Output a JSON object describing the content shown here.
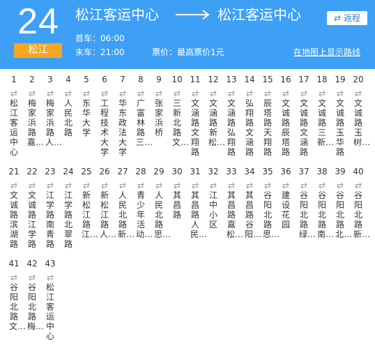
{
  "header": {
    "route_number": "24",
    "district": "松江",
    "from": "松江客运中心",
    "to": "松江客运中心",
    "first_bus": "首车：06:00",
    "last_bus": "末车：21:00",
    "price": "票价：最高票价1元",
    "return_label": "⇄ 返程",
    "map_link": "在地图上显示路线",
    "bg_color": "#3ea0f5",
    "badge_color": "#f5a623"
  },
  "stops": [
    {
      "num": "1",
      "sym": "⇄",
      "name": "松江客运中心"
    },
    {
      "num": "2",
      "sym": "⇄",
      "name": "梅家浜路嘉…"
    },
    {
      "num": "3",
      "sym": "⇄",
      "name": "梅家浜路人…"
    },
    {
      "num": "4",
      "sym": "⇄",
      "name": "人民北路"
    },
    {
      "num": "5",
      "sym": "⇄",
      "name": "东华大学"
    },
    {
      "num": "6",
      "sym": "⇄",
      "name": "工程技术大学"
    },
    {
      "num": "7",
      "sym": "⇄",
      "name": "华东政法大学"
    },
    {
      "num": "8",
      "sym": "⇄",
      "name": "广富林路三…"
    },
    {
      "num": "9",
      "sym": "⇄",
      "name": "张家浜桥"
    },
    {
      "num": "10",
      "sym": "⇄",
      "name": "三新北路文…"
    },
    {
      "num": "11",
      "sym": "⇄",
      "name": "文涵路文翔路"
    },
    {
      "num": "12",
      "sym": "⇄",
      "name": "文涵路新松…"
    },
    {
      "num": "13",
      "sym": "⇄",
      "name": "文涵路弘翔路"
    },
    {
      "num": "14",
      "sym": "⇄",
      "name": "弘翔路文涵路"
    },
    {
      "num": "15",
      "sym": "⇄",
      "name": "辰塔路天翔路"
    },
    {
      "num": "16",
      "sym": "⇄",
      "name": "文诚路辰塔路"
    },
    {
      "num": "17",
      "sym": "⇄",
      "name": "文诚路文涵路"
    },
    {
      "num": "18",
      "sym": "⇄",
      "name": "文诚路三新…"
    },
    {
      "num": "19",
      "sym": "⇄",
      "name": "文诚路玉华路"
    },
    {
      "num": "20",
      "sym": "⇄",
      "name": "文诚路玉树…"
    },
    {
      "num": "21",
      "sym": "⇄",
      "name": "文诚路滨湖路"
    },
    {
      "num": "22",
      "sym": "⇄",
      "name": "文诚路江学路"
    },
    {
      "num": "23",
      "sym": "⇄",
      "name": "江学路南青路"
    },
    {
      "num": "24",
      "sym": "⇄",
      "name": "江学路北翠路"
    },
    {
      "num": "25",
      "sym": "⇄",
      "name": "新松江路江…"
    },
    {
      "num": "26",
      "sym": "⇄",
      "name": "新松江路人…"
    },
    {
      "num": "27",
      "sym": "⇄",
      "name": "人民北路新…"
    },
    {
      "num": "28",
      "sym": "⇄",
      "name": "青少年活动…"
    },
    {
      "num": "29",
      "sym": "⇄",
      "name": "人民北路思…"
    },
    {
      "num": "30",
      "sym": "⇄",
      "name": "其昌路"
    },
    {
      "num": "31",
      "sym": "⇄",
      "name": "其昌路人民…"
    },
    {
      "num": "32",
      "sym": "⇄",
      "name": "江中小区"
    },
    {
      "num": "33",
      "sym": "⇄",
      "name": "其昌路嘉松…"
    },
    {
      "num": "34",
      "sym": "⇄",
      "name": "其昌路谷阳…"
    },
    {
      "num": "35",
      "sym": "⇄",
      "name": "谷阳北路思…"
    },
    {
      "num": "36",
      "sym": "⇄",
      "name": "建设花园"
    },
    {
      "num": "37",
      "sym": "⇄",
      "name": "谷阳北路绿…"
    },
    {
      "num": "38",
      "sym": "⇄",
      "name": "谷阳北路南…"
    },
    {
      "num": "39",
      "sym": "⇄",
      "name": "谷阳北路北…"
    },
    {
      "num": "40",
      "sym": "⇄",
      "name": "谷阳北路新…"
    },
    {
      "num": "41",
      "sym": "⇄",
      "name": "谷阳北路文…"
    },
    {
      "num": "42",
      "sym": "⇄",
      "name": "谷阳北路梅…"
    },
    {
      "num": "43",
      "sym": "⇄",
      "name": "松江客运中心"
    }
  ]
}
